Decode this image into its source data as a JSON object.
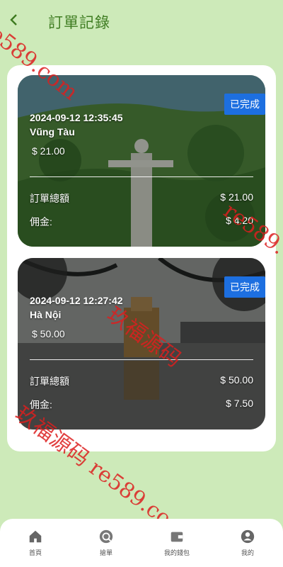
{
  "header": {
    "title": "訂單記錄",
    "back_icon": "chevron-left-icon"
  },
  "orders": [
    {
      "status": "已完成",
      "datetime": "2024-09-12 12:35:45",
      "place": "Vũng Tàu",
      "amount": "$ 21.00",
      "total_label": "訂單總額",
      "total_value": "$ 21.00",
      "commission_label": "佣金:",
      "commission_value": "$ 4.20"
    },
    {
      "status": "已完成",
      "datetime": "2024-09-12 12:27:42",
      "place": "Hà Nội",
      "amount": "$ 50.00",
      "total_label": "訂單總額",
      "total_value": "$ 50.00",
      "commission_label": "佣金:",
      "commission_value": "$ 7.50"
    }
  ],
  "tabbar": [
    {
      "label": "首頁",
      "icon": "home-icon"
    },
    {
      "label": "搶單",
      "icon": "grab-order-icon"
    },
    {
      "label": "我的錢包",
      "icon": "wallet-icon"
    },
    {
      "label": "我的",
      "icon": "user-icon"
    }
  ],
  "watermark": {
    "line1": "e589.com",
    "line2": "玖福源码",
    "line3": "re589.",
    "line4": "玖福源码 re589.co"
  },
  "colors": {
    "background": "#cdeab9",
    "accent": "#3f7d22",
    "badge": "#1d6fe0"
  }
}
